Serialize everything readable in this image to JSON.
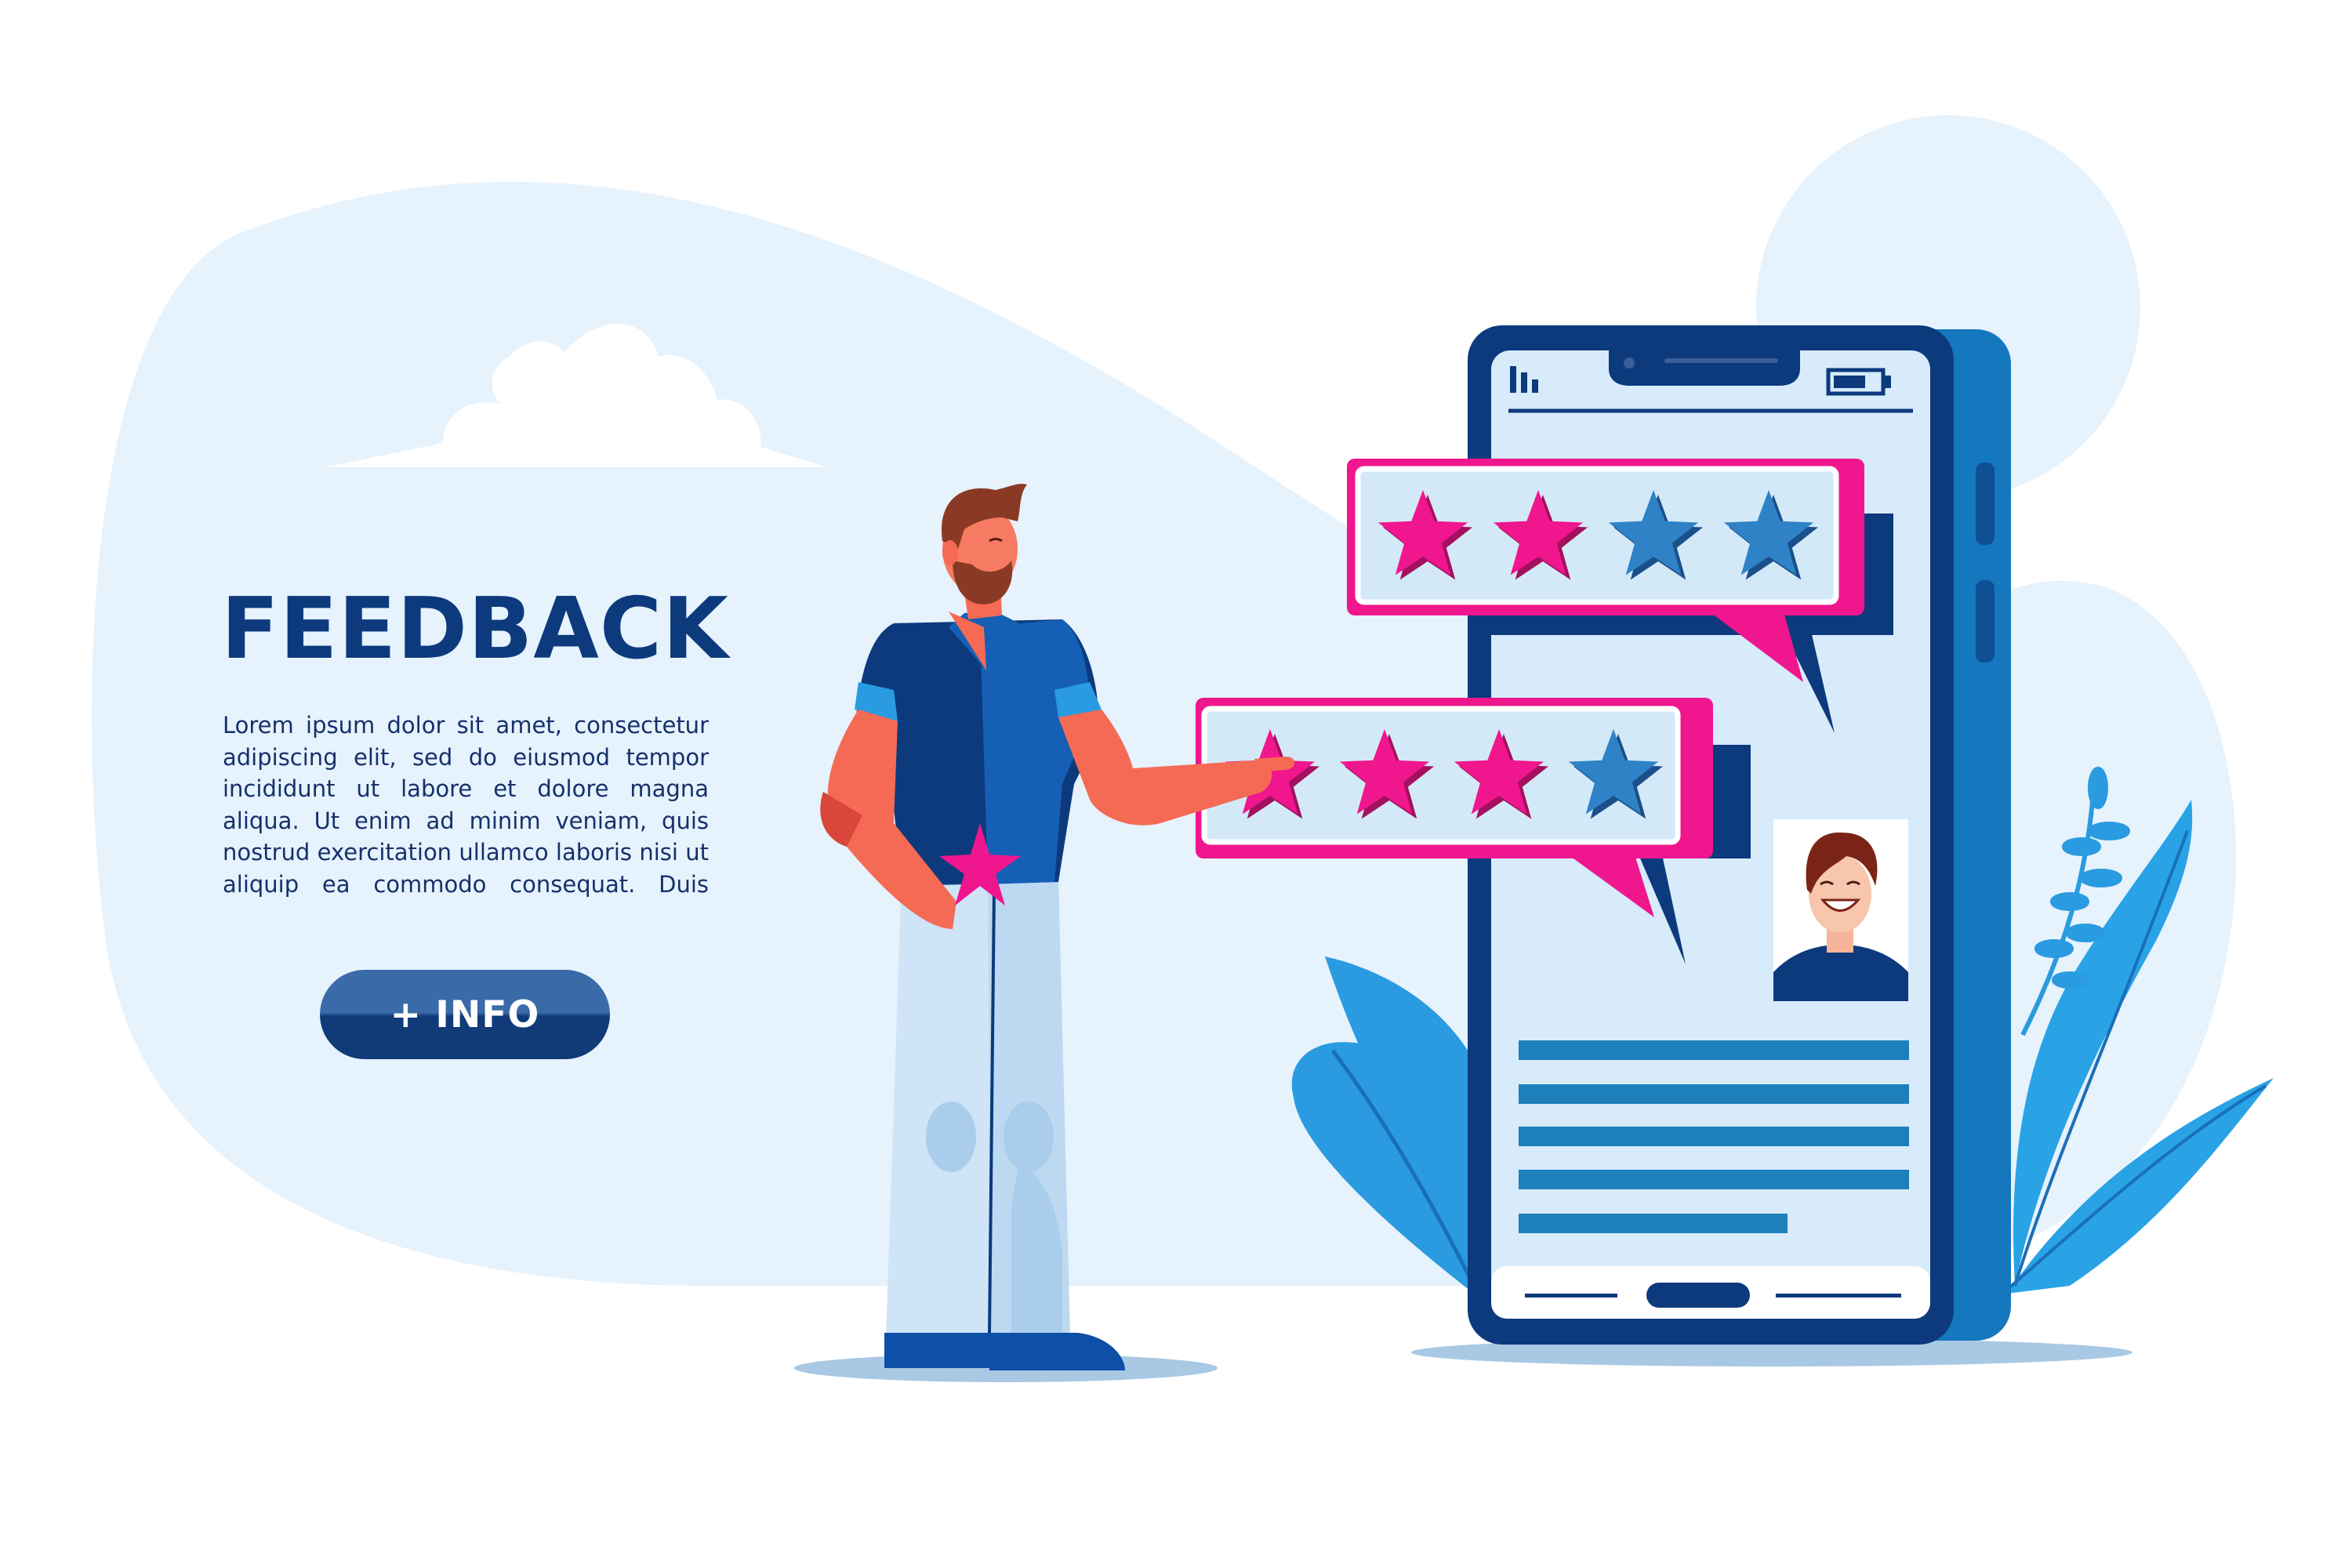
{
  "heading": "FEEDBACK",
  "body_text": "Lorem ipsum dolor sit amet, consectetur adipiscing elit, sed do eiusmod tempor incididunt ut labore et dolore magna aliqua. Ut enim ad minim veniam, quis nostrud exercitation ullamco laboris nisi ut aliquip  ea commodo consequat. Duis",
  "info_button": {
    "label": "+ INFO"
  },
  "ratings": [
    {
      "filled_stars": 2,
      "total_stars": 4
    },
    {
      "filled_stars": 3,
      "total_stars": 4
    }
  ],
  "colors": {
    "brand_navy": "#0d3a7d",
    "accent_pink": "#f0168d",
    "star_blue": "#2f82c6",
    "background_blob": "#e6f2fc",
    "leaf_blue": "#29a3e6"
  },
  "icons": {
    "status": "signal-bars-icon",
    "battery": "battery-icon",
    "avatar": "user-avatar-icon"
  }
}
